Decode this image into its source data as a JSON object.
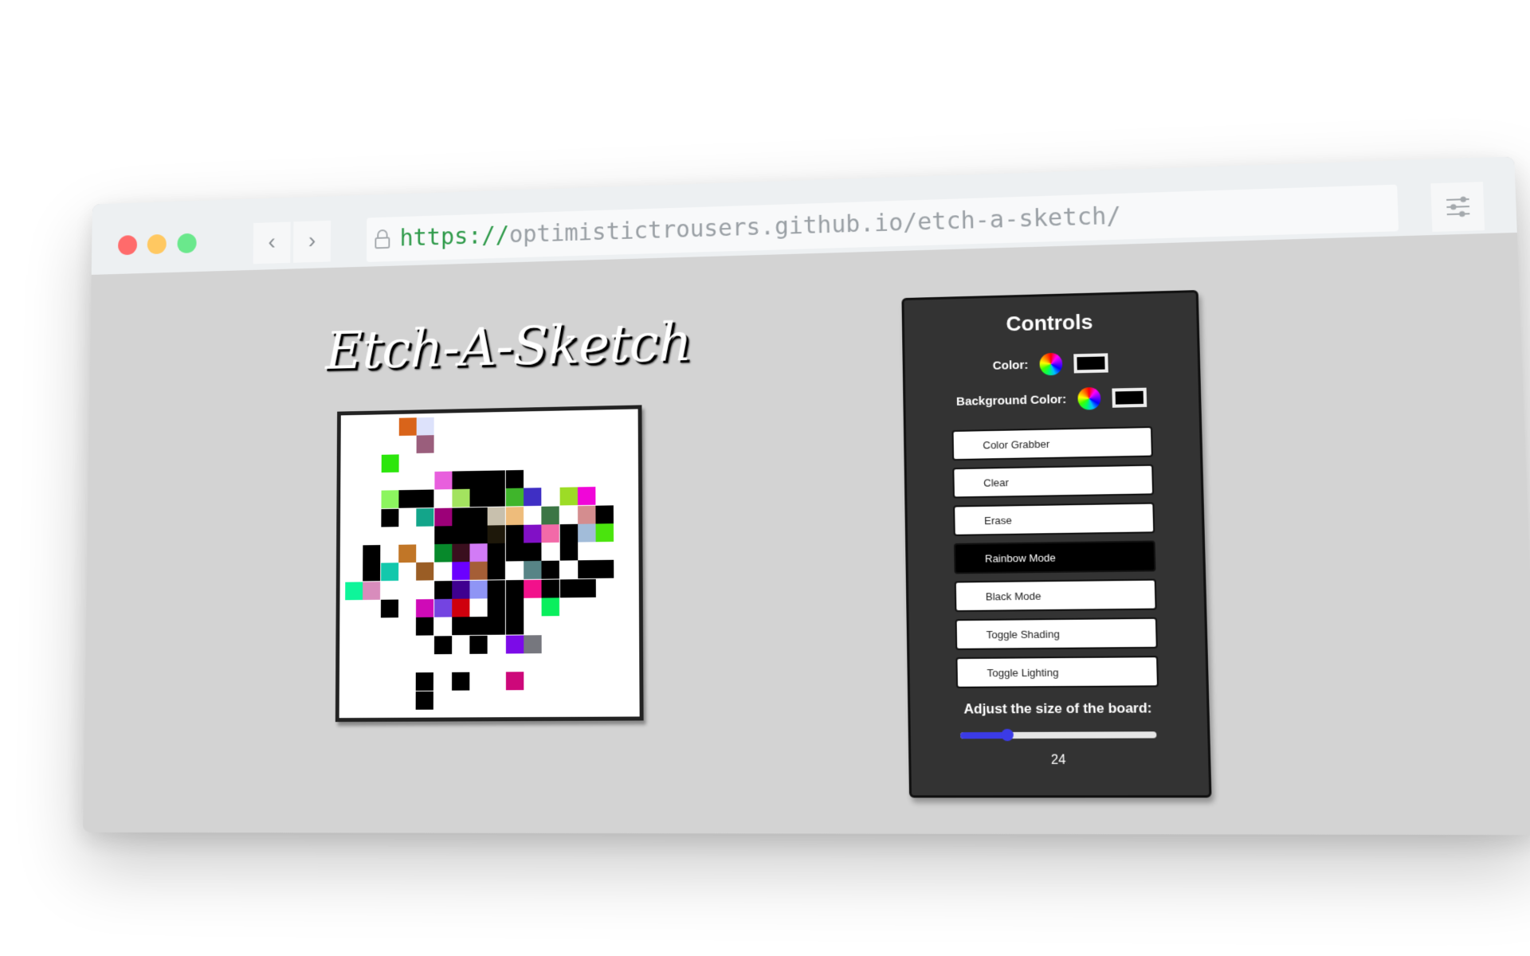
{
  "browser": {
    "url_scheme": "https://",
    "url_rest": "optimistictrousers.github.io/etch-a-sketch/",
    "back_glyph": "‹",
    "forward_glyph": "›",
    "icons": [
      "lock-icon",
      "settings-sliders-icon",
      "back-icon",
      "forward-icon"
    ]
  },
  "page": {
    "title": "Etch-A-Sketch"
  },
  "controls": {
    "heading": "Controls",
    "color_label": "Color:",
    "background_color_label": "Background Color:",
    "color_value": "#000000",
    "background_color_value": "#000000",
    "buttons": [
      {
        "label": "Color Grabber",
        "active": false
      },
      {
        "label": "Clear",
        "active": false
      },
      {
        "label": "Erase",
        "active": false
      },
      {
        "label": "Rainbow Mode",
        "active": true
      },
      {
        "label": "Black Mode",
        "active": false
      },
      {
        "label": "Toggle Shading",
        "active": false
      },
      {
        "label": "Toggle Lighting",
        "active": false
      }
    ],
    "size_label": "Adjust the size of the board:",
    "size_value": "24",
    "size_slider_fraction": 0.24,
    "accent_color": "#3b3be6"
  },
  "board": {
    "background": "#ffffff",
    "cells": [
      [
        0,
        3,
        "#d9641a"
      ],
      [
        0,
        4,
        "#dde2fb"
      ],
      [
        1,
        4,
        "#9a5e7c"
      ],
      [
        2,
        2,
        "#2ce60c"
      ],
      [
        3,
        5,
        "#e85fdd"
      ],
      [
        3,
        6,
        "#000000"
      ],
      [
        3,
        7,
        "#000000"
      ],
      [
        3,
        8,
        "#000000"
      ],
      [
        3,
        9,
        "#000000"
      ],
      [
        4,
        2,
        "#8cf55f"
      ],
      [
        4,
        3,
        "#000000"
      ],
      [
        4,
        4,
        "#000000"
      ],
      [
        4,
        6,
        "#a3e35f"
      ],
      [
        4,
        7,
        "#000000"
      ],
      [
        4,
        8,
        "#000000"
      ],
      [
        4,
        9,
        "#3fb52b"
      ],
      [
        4,
        10,
        "#3f2fc4"
      ],
      [
        4,
        12,
        "#9ddc26"
      ],
      [
        4,
        13,
        "#f006d8"
      ],
      [
        5,
        2,
        "#000000"
      ],
      [
        5,
        4,
        "#13a58a"
      ],
      [
        5,
        5,
        "#9c0078"
      ],
      [
        5,
        6,
        "#000000"
      ],
      [
        5,
        7,
        "#000000"
      ],
      [
        5,
        8,
        "#c8c0ad"
      ],
      [
        5,
        9,
        "#eebc7b"
      ],
      [
        5,
        11,
        "#3c7645"
      ],
      [
        5,
        13,
        "#d48d8f"
      ],
      [
        5,
        14,
        "#000000"
      ],
      [
        6,
        5,
        "#000000"
      ],
      [
        6,
        6,
        "#000000"
      ],
      [
        6,
        7,
        "#000000"
      ],
      [
        6,
        8,
        "#1e180a"
      ],
      [
        6,
        9,
        "#000000"
      ],
      [
        6,
        10,
        "#8110c6"
      ],
      [
        6,
        11,
        "#f26aa8"
      ],
      [
        6,
        12,
        "#000000"
      ],
      [
        6,
        13,
        "#a2bcd9"
      ],
      [
        6,
        14,
        "#4ae40d"
      ],
      [
        7,
        1,
        "#000000"
      ],
      [
        7,
        3,
        "#c17627"
      ],
      [
        7,
        5,
        "#07892b"
      ],
      [
        7,
        6,
        "#3a0f1e"
      ],
      [
        7,
        7,
        "#d27bf6"
      ],
      [
        7,
        8,
        "#000000"
      ],
      [
        7,
        9,
        "#000000"
      ],
      [
        7,
        10,
        "#000000"
      ],
      [
        7,
        12,
        "#000000"
      ],
      [
        8,
        1,
        "#000000"
      ],
      [
        8,
        2,
        "#13c8ac"
      ],
      [
        8,
        4,
        "#9a5d25"
      ],
      [
        8,
        6,
        "#6b00ff"
      ],
      [
        8,
        7,
        "#a55e36"
      ],
      [
        8,
        8,
        "#000000"
      ],
      [
        8,
        10,
        "#578486"
      ],
      [
        8,
        11,
        "#000000"
      ],
      [
        8,
        13,
        "#000000"
      ],
      [
        8,
        14,
        "#000000"
      ],
      [
        9,
        0,
        "#0ef59a"
      ],
      [
        9,
        1,
        "#d88cbc"
      ],
      [
        9,
        5,
        "#000000"
      ],
      [
        9,
        6,
        "#3f0090"
      ],
      [
        9,
        7,
        "#8f95f5"
      ],
      [
        9,
        8,
        "#000000"
      ],
      [
        9,
        9,
        "#000000"
      ],
      [
        9,
        10,
        "#f2118b"
      ],
      [
        9,
        11,
        "#000000"
      ],
      [
        9,
        12,
        "#000000"
      ],
      [
        9,
        13,
        "#000000"
      ],
      [
        10,
        2,
        "#000000"
      ],
      [
        10,
        4,
        "#cf0ab7"
      ],
      [
        10,
        5,
        "#7444e1"
      ],
      [
        10,
        6,
        "#cf000d"
      ],
      [
        10,
        8,
        "#000000"
      ],
      [
        10,
        9,
        "#000000"
      ],
      [
        10,
        11,
        "#09ef5d"
      ],
      [
        11,
        4,
        "#000000"
      ],
      [
        11,
        6,
        "#000000"
      ],
      [
        11,
        7,
        "#000000"
      ],
      [
        11,
        8,
        "#000000"
      ],
      [
        11,
        9,
        "#000000"
      ],
      [
        12,
        5,
        "#000000"
      ],
      [
        12,
        7,
        "#000000"
      ],
      [
        12,
        9,
        "#7c0be8"
      ],
      [
        12,
        10,
        "#76777e"
      ],
      [
        14,
        4,
        "#000000"
      ],
      [
        14,
        6,
        "#000000"
      ],
      [
        14,
        9,
        "#cd087a"
      ],
      [
        15,
        4,
        "#000000"
      ]
    ]
  }
}
